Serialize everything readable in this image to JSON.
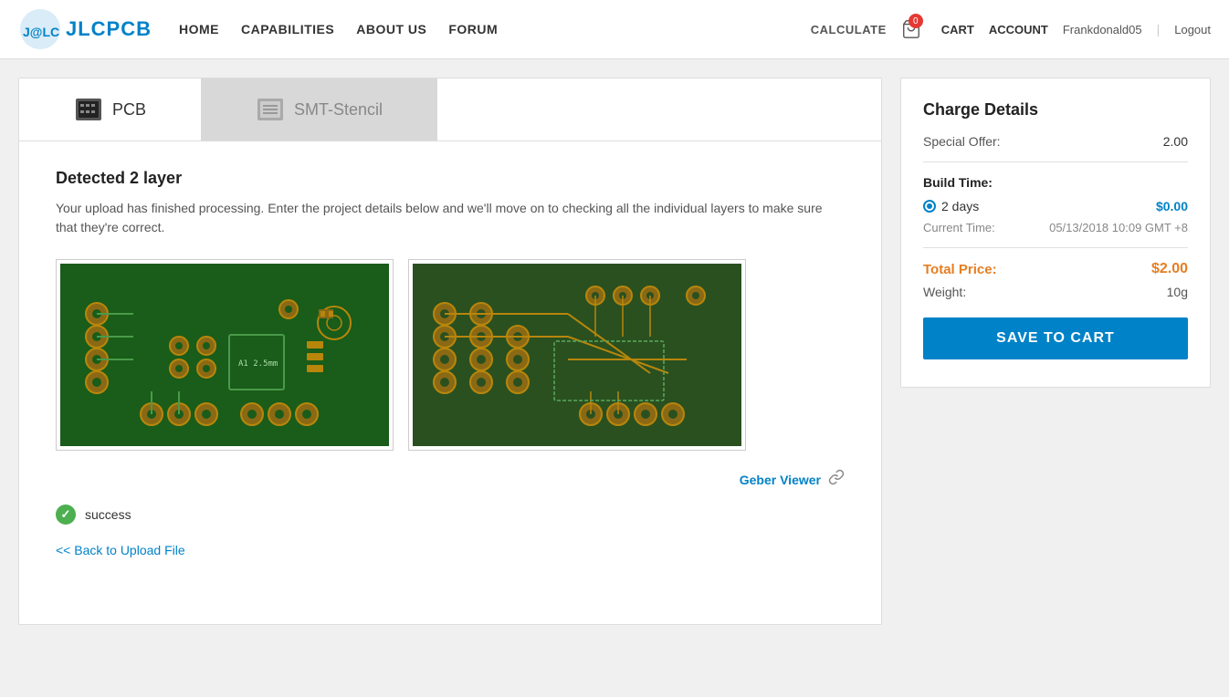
{
  "header": {
    "logo_text": "JLCPCB",
    "nav": [
      {
        "label": "HOME",
        "id": "home"
      },
      {
        "label": "CAPABILITIES",
        "id": "capabilities"
      },
      {
        "label": "ABOUT US",
        "id": "about"
      },
      {
        "label": "FORUM",
        "id": "forum"
      }
    ],
    "calculate": "CALCULATE",
    "cart_label": "CART",
    "cart_count": "0",
    "account_label": "ACCOUNT",
    "username": "Frankdonald05",
    "logout": "Logout"
  },
  "tabs": [
    {
      "label": "PCB",
      "id": "pcb",
      "active": true
    },
    {
      "label": "SMT-Stencil",
      "id": "smt",
      "active": false
    }
  ],
  "detected": {
    "title": "Detected 2 layer",
    "description": "Your upload has finished processing. Enter the project details below and we'll move on to checking all the individual layers to make sure that they're correct."
  },
  "geber_viewer": "Geber Viewer",
  "success_text": "success",
  "back_link": "<< Back to Upload File",
  "charge": {
    "title": "Charge Details",
    "special_offer_label": "Special Offer:",
    "special_offer_value": "2.00",
    "build_time_label": "Build Time:",
    "build_days": "2 days",
    "build_price": "$0.00",
    "current_time_label": "Current Time:",
    "current_time_value": "05/13/2018 10:09 GMT +8",
    "total_label": "Total Price:",
    "total_value": "$2.00",
    "weight_label": "Weight:",
    "weight_value": "10g",
    "save_button": "SAVE TO CART"
  }
}
